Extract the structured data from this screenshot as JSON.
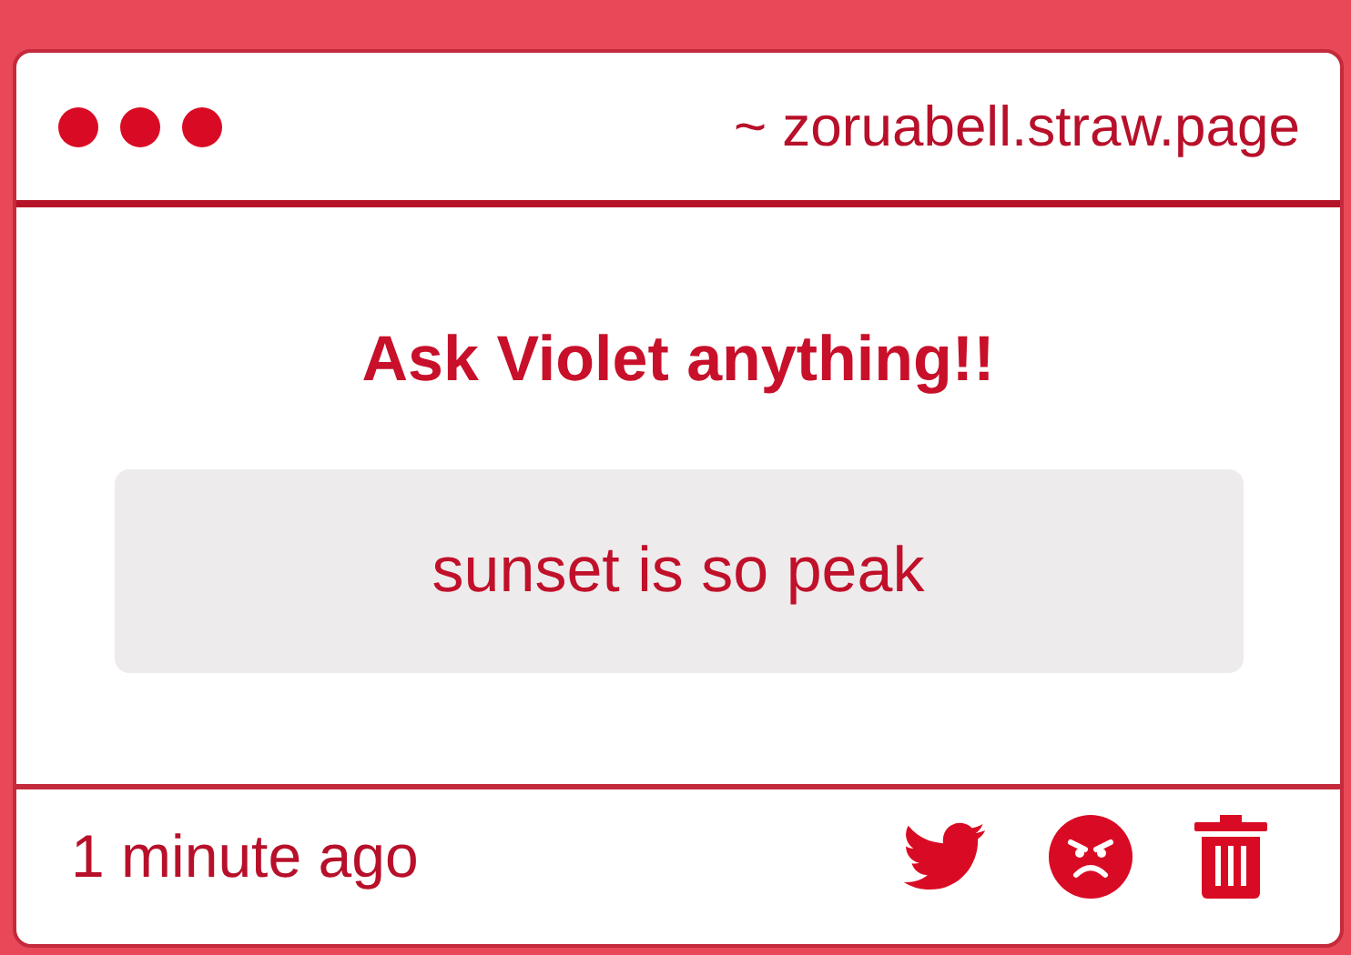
{
  "window": {
    "address": "~ zoruabell.straw.page"
  },
  "card": {
    "title": "Ask Violet anything!!",
    "message": "sunset is so peak"
  },
  "footer": {
    "time": "1 minute ago"
  }
}
